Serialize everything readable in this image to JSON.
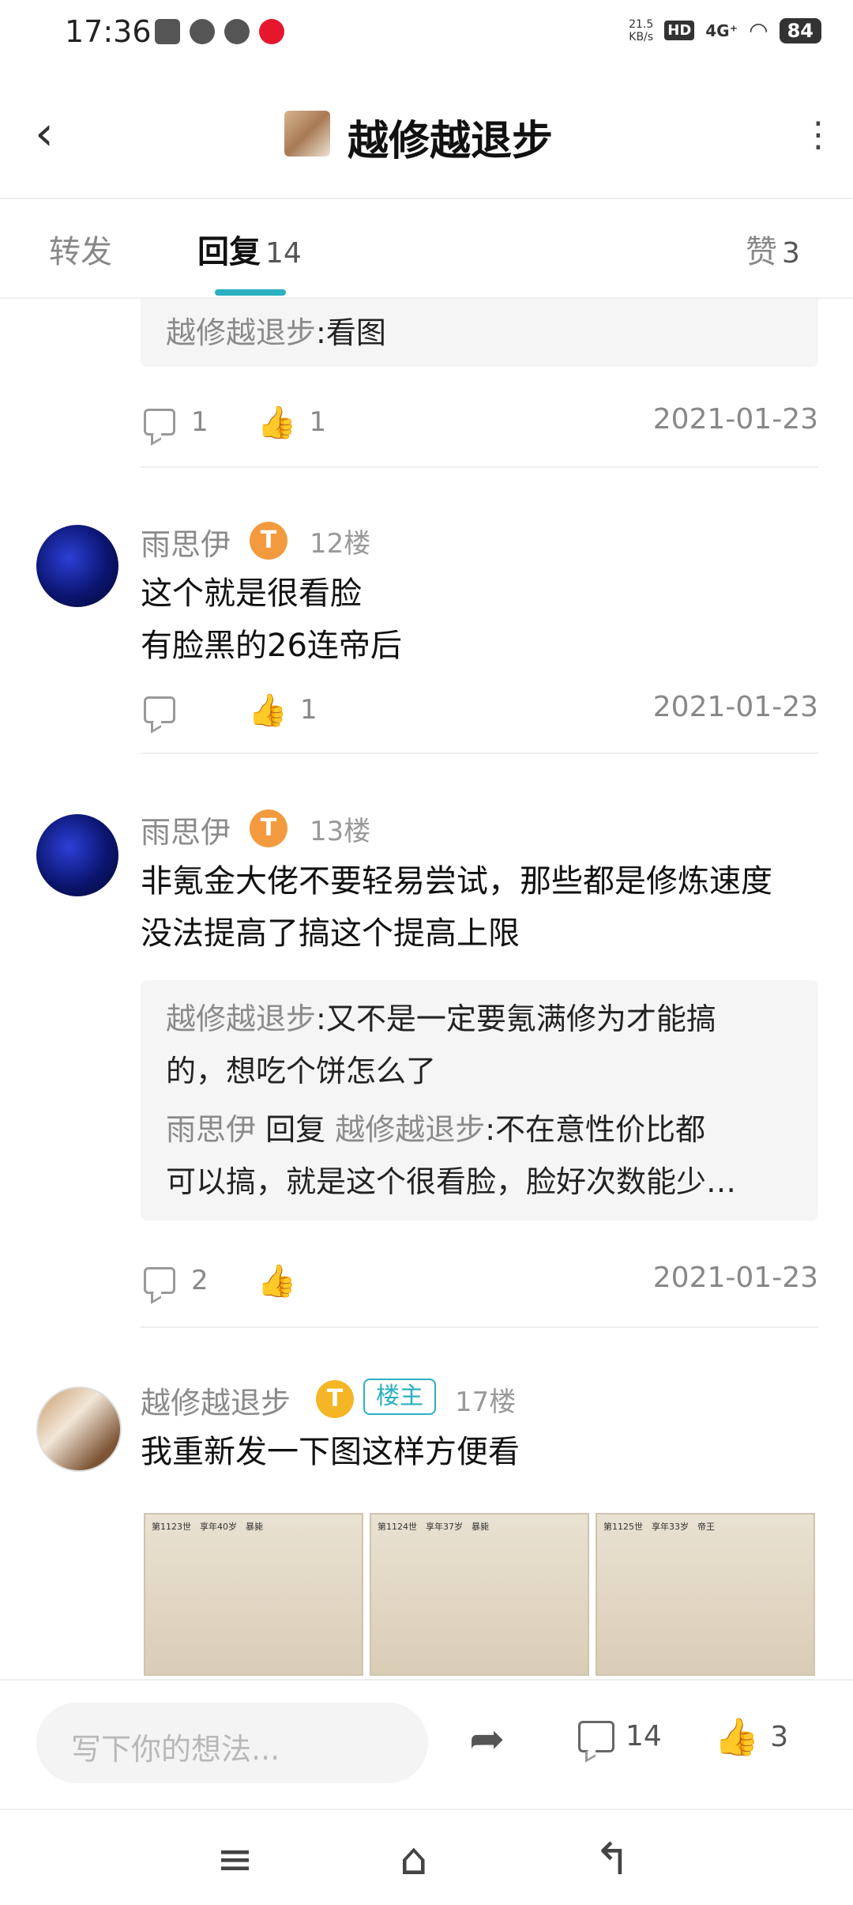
{
  "status": {
    "time": "17:36",
    "speed": "21.5\nKB/s",
    "hd": "HD",
    "net": "4G⁺",
    "battery": "84"
  },
  "header": {
    "title": "越修越退步"
  },
  "tabs": {
    "repost": "转发",
    "reply": "回复",
    "reply_count": "14",
    "like": "赞",
    "like_count": "3"
  },
  "prev_post": {
    "quote_user": "越修越退步",
    "quote_text": ":看图",
    "comments": "1",
    "likes": "1",
    "date": "2021-01-23"
  },
  "post12": {
    "user": "雨思伊",
    "badge": "T",
    "floor": "12楼",
    "line1": "这个就是很看脸",
    "line2": "有脸黑的26连帝后",
    "comments": "",
    "likes": "1",
    "date": "2021-01-23"
  },
  "post13": {
    "user": "雨思伊",
    "badge": "T",
    "floor": "13楼",
    "line1": "非氪金大佬不要轻易尝试，那些都是修炼速度",
    "line2": "没法提高了搞这个提高上限",
    "q1_user": "越修越退步",
    "q1_line1": ":又不是一定要氪满修为才能搞",
    "q1_line2": "的，想吃个饼怎么了",
    "q2_user": "雨思伊",
    "q2_reply": "回复",
    "q2_target": "越修越退步",
    "q2_line1": ":不在意性价比都",
    "q2_line2": "可以搞，就是这个很看脸，脸好次数能少…",
    "comments": "2",
    "likes": "",
    "date": "2021-01-23"
  },
  "post17": {
    "user": "越修越退步",
    "badge": "T",
    "owner": "楼主",
    "floor": "17楼",
    "text": "我重新发一下图这样方便看",
    "images": [
      {
        "head": "第1123世　享年40岁　暴毙"
      },
      {
        "head": "第1124世　享年37岁　暴毙"
      },
      {
        "head": "第1125世　享年33岁　帝王"
      }
    ]
  },
  "bottom": {
    "placeholder": "写下你的想法...",
    "comments": "14",
    "likes": "3"
  }
}
